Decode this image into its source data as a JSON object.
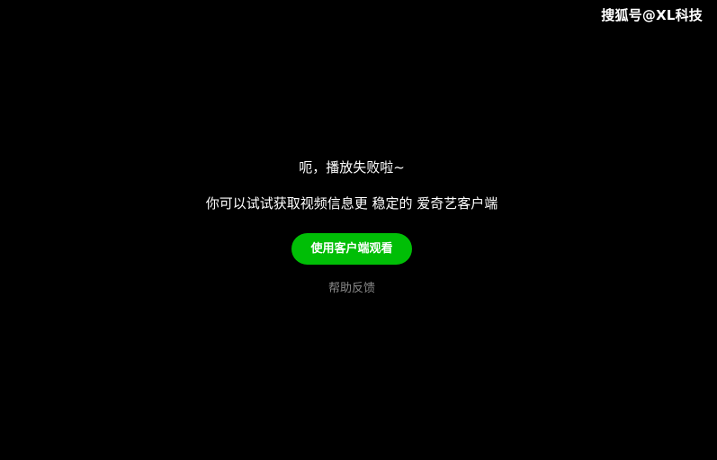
{
  "watermark": {
    "text": "搜狐号@XL科技"
  },
  "error": {
    "title": "呃，播放失败啦~",
    "subtitle": "你可以试试获取视频信息更 稳定的 爱奇艺客户端",
    "button_label": "使用客户端观看",
    "help_label": "帮助反馈"
  },
  "colors": {
    "background": "#000000",
    "accent": "#00be06",
    "text": "#ffffff",
    "muted": "#8a8a8a"
  }
}
